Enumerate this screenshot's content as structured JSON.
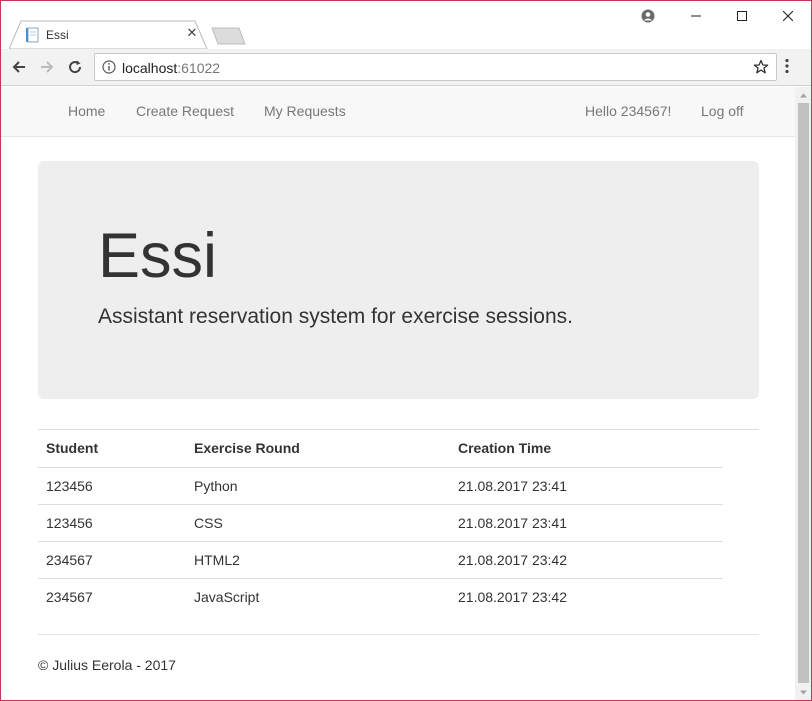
{
  "browser": {
    "tab_title": "Essi",
    "url_host": "localhost",
    "url_port": ":61022"
  },
  "nav": {
    "left_links": [
      "Home",
      "Create Request",
      "My Requests"
    ],
    "greeting": "Hello 234567!",
    "logoff": "Log off"
  },
  "jumbotron": {
    "title": "Essi",
    "lead": "Assistant reservation system for exercise sessions."
  },
  "table": {
    "headers": [
      "Student",
      "Exercise Round",
      "Creation Time"
    ],
    "rows": [
      [
        "123456",
        "Python",
        "21.08.2017 23:41"
      ],
      [
        "123456",
        "CSS",
        "21.08.2017 23:41"
      ],
      [
        "234567",
        "HTML2",
        "21.08.2017 23:42"
      ],
      [
        "234567",
        "JavaScript",
        "21.08.2017 23:42"
      ]
    ]
  },
  "footer": {
    "text": "© Julius Eerola - 2017"
  },
  "colors": {
    "window_border": "#c3385a",
    "nav_bg": "#f8f8f8",
    "jumbotron_bg": "#eeeeee",
    "link_color": "#777777"
  }
}
